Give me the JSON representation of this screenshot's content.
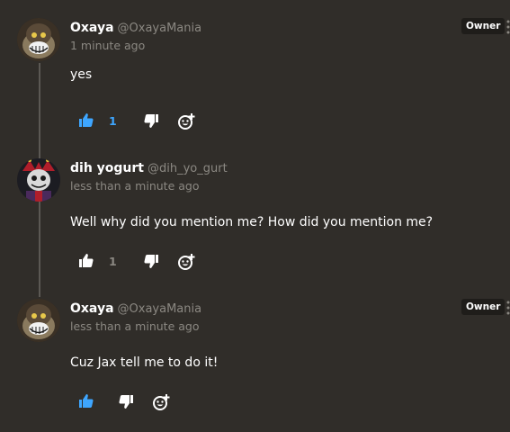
{
  "colors": {
    "background": "#302d29",
    "like_active": "#3ea6ff",
    "icon_default": "#ffffff",
    "secondary_text": "#8b8882",
    "badge_bg": "#1f1d1a"
  },
  "comments": [
    {
      "username": "Oxaya",
      "handle": "@OxayaMania",
      "time": "1 minute ago",
      "text": "yes",
      "badge": "Owner",
      "likes": "1",
      "liked": true,
      "avatar": "grinning-cartoon-avatar"
    },
    {
      "username": "dih yogurt",
      "handle": "@dih_yo_gurt",
      "time": "less than a minute ago",
      "text": "Well why did you mention me? How did you mention me?",
      "badge": "",
      "likes": "1",
      "liked": false,
      "avatar": "jester-character-avatar"
    },
    {
      "username": "Oxaya",
      "handle": "@OxayaMania",
      "time": "less than a minute ago",
      "text": "Cuz Jax tell me to do it!",
      "badge": "Owner",
      "likes": "",
      "liked": true,
      "avatar": "grinning-cartoon-avatar"
    }
  ],
  "icons": {
    "like": "thumb-up-icon",
    "dislike": "thumb-down-icon",
    "react": "add-reaction-icon",
    "more": "more-options-icon"
  }
}
